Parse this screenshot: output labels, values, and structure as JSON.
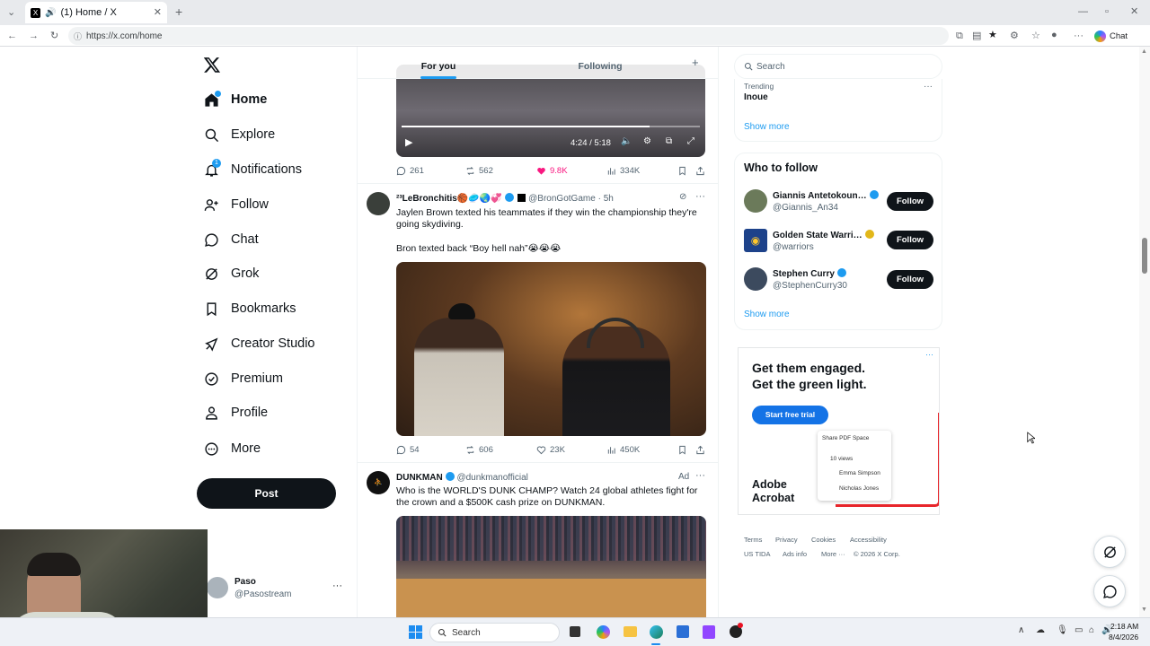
{
  "browser": {
    "tab_title": "(1) Home / X",
    "url": "https://x.com/home",
    "chat_label": "Chat"
  },
  "nav": {
    "items": [
      {
        "label": "Home",
        "icon": "home-icon"
      },
      {
        "label": "Explore",
        "icon": "search-icon"
      },
      {
        "label": "Notifications",
        "icon": "bell-icon",
        "badge": "1"
      },
      {
        "label": "Follow",
        "icon": "add-user-icon"
      },
      {
        "label": "Chat",
        "icon": "chat-icon"
      },
      {
        "label": "Grok",
        "icon": "grok-icon"
      },
      {
        "label": "Bookmarks",
        "icon": "bookmark-icon"
      },
      {
        "label": "Creator Studio",
        "icon": "rocket-icon"
      },
      {
        "label": "Premium",
        "icon": "premium-icon"
      },
      {
        "label": "Profile",
        "icon": "profile-icon"
      },
      {
        "label": "More",
        "icon": "more-circle-icon"
      }
    ],
    "post_label": "Post"
  },
  "account": {
    "name": "Paso",
    "handle": "@Pasostream"
  },
  "feed": {
    "tabs": [
      "For you",
      "Following"
    ],
    "video_time": "4:24 / 5:18",
    "post1_actions": {
      "replies": "261",
      "reposts": "562",
      "likes": "9.8K",
      "views": "334K"
    },
    "post2": {
      "author": "²³LeBronchitis🏀🥏🌏💞",
      "handle": "@BronGotGame",
      "time": "5h",
      "text1": "Jaylen Brown texted his teammates if they win the championship they're going skydiving.",
      "text2": "Bron texted back “Boy hell nah”😭😭😭",
      "replies": "54",
      "reposts": "606",
      "likes": "23K",
      "views": "450K"
    },
    "post3": {
      "author": "DUNKMAN",
      "handle": "@dunkmanofficial",
      "ad": "Ad",
      "text": "Who is the WORLD'S DUNK CHAMP? Watch 24 global athletes fight for the crown and a $500K cash prize on DUNKMAN."
    }
  },
  "right": {
    "search_placeholder": "Search",
    "trending_label": "Trending",
    "trending_topic": "Inoue",
    "show_more": "Show more",
    "who_to_follow_title": "Who to follow",
    "follow_label": "Follow",
    "people": [
      {
        "name": "Giannis Antetokoun…",
        "handle": "@Giannis_An34",
        "badge": "blue"
      },
      {
        "name": "Golden State Warri…",
        "handle": "@warriors",
        "badge": "gold"
      },
      {
        "name": "Stephen Curry",
        "handle": "@StephenCurry30",
        "badge": "blue"
      }
    ],
    "ad": {
      "headline1": "Get them engaged.",
      "headline2": "Get the green light.",
      "cta": "Start free trial",
      "brand1": "Adobe",
      "brand2": "Acrobat",
      "ui_share": "Share PDF Space",
      "ui_views": "10 views",
      "ui_user1": "Emma Simpson",
      "ui_user2": "Nicholas Jones"
    },
    "footer": [
      "Terms",
      "Privacy",
      "Cookies",
      "Accessibility",
      "US TIDA",
      "Ads info",
      "More ···",
      "© 2026 X Corp."
    ]
  },
  "taskbar": {
    "search_label": "Search",
    "time": "2:18 AM",
    "date": "8/4/2026"
  }
}
